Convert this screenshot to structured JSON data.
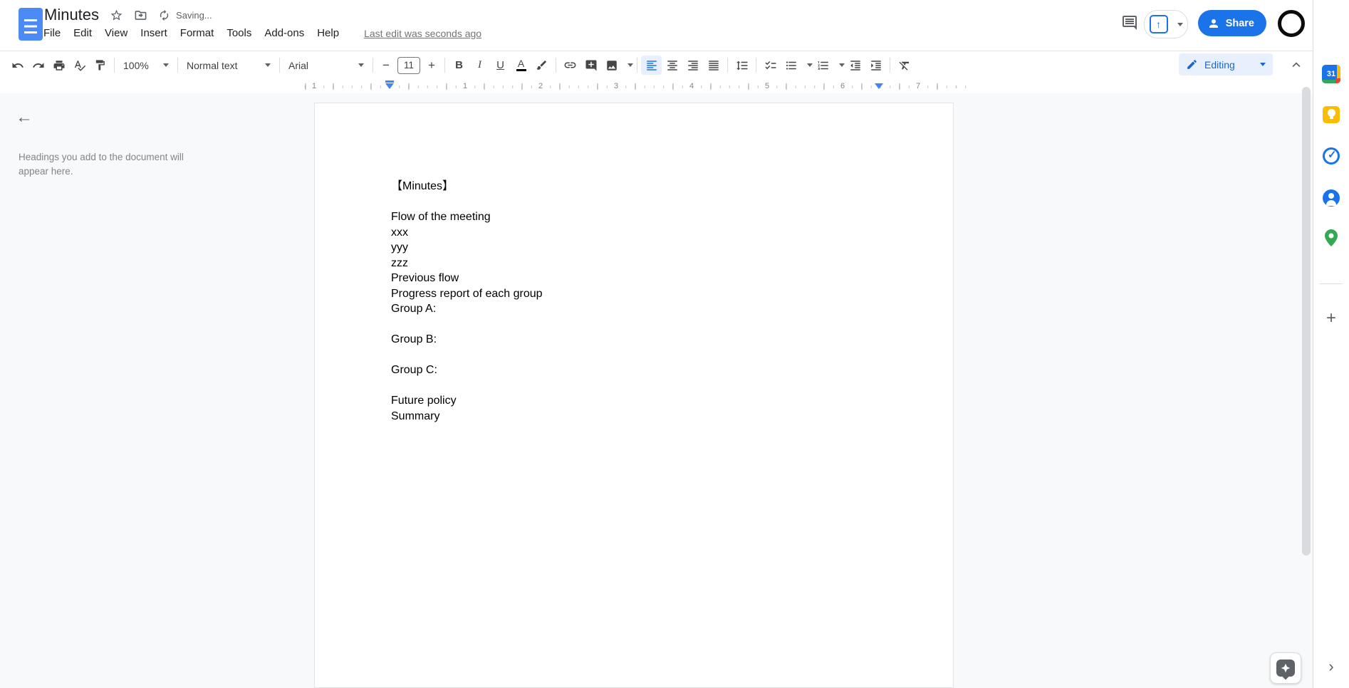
{
  "header": {
    "doc_title": "Minutes",
    "saving_status": "Saving...",
    "menus": [
      "File",
      "Edit",
      "View",
      "Insert",
      "Format",
      "Tools",
      "Add-ons",
      "Help"
    ],
    "last_edit_status": "Last edit was seconds ago",
    "share_label": "Share"
  },
  "toolbar": {
    "zoom_value": "100%",
    "paragraph_style": "Normal text",
    "font_family": "Arial",
    "font_size": "11",
    "bold_label": "B",
    "italic_label": "I",
    "underline_label": "U",
    "text_color_label": "A",
    "mode_label": "Editing"
  },
  "outline_panel": {
    "placeholder": "Headings you add to the document will appear here."
  },
  "ruler": {
    "numbers": [
      "1",
      "1",
      "2",
      "3",
      "4",
      "5",
      "6",
      "7"
    ]
  },
  "document_page": {
    "lines": [
      "【Minutes】",
      "",
      "Flow of the meeting",
      "xxx",
      "yyy",
      "zzz",
      "Previous flow",
      "Progress report of each group",
      "Group A:",
      "",
      "Group B:",
      "",
      "Group C:",
      "",
      "Future policy",
      "Summary"
    ]
  },
  "side_panel": {
    "calendar_day": "31"
  },
  "icons": {
    "back_arrow": "←",
    "plus": "+",
    "hide_panel_chevron": "›",
    "tasks_check": "✓",
    "font_size_minus": "−",
    "font_size_plus": "+",
    "present_arrow": "↑"
  },
  "colors": {
    "share_button_blue": "#1a73e8",
    "editing_chip_bg": "#e8f0fe",
    "editing_chip_text": "#1967d2",
    "active_toolbar_bg": "#e8f0fe",
    "docs_logo_blue": "#4c8bf5",
    "ruler_marker_blue": "#4285f4",
    "content_bg": "#f8f9fa"
  }
}
